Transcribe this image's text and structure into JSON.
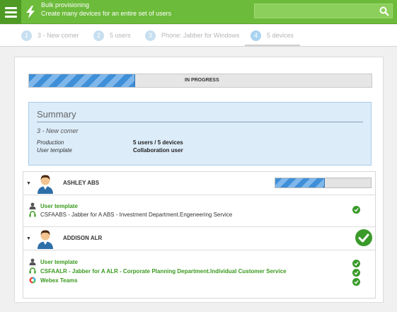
{
  "header": {
    "title": "Bulk provisioning",
    "subtitle": "Create many devices for an entire set of users",
    "search_value": ""
  },
  "steps": [
    {
      "num": "1",
      "label": "3 - New comer"
    },
    {
      "num": "2",
      "label": "5 users"
    },
    {
      "num": "3",
      "label": "Phone: Jabber for Windows"
    },
    {
      "num": "4",
      "label": "5 devices"
    }
  ],
  "progress": {
    "label": "IN PROGRESS",
    "fraction": 0.31
  },
  "summary": {
    "title": "Summary",
    "subtitle": "3 - New comer",
    "rows": [
      {
        "label": "Production",
        "value": "5 users / 5 devices"
      },
      {
        "label": "User template",
        "value": "Collaboration user"
      }
    ]
  },
  "users": [
    {
      "name": "ASHLEY ABS",
      "progress_fraction": 0.52,
      "items": [
        {
          "icon": "person-icon",
          "text": "User template",
          "style": "green"
        },
        {
          "icon": "headset-icon",
          "text": "CSFAABS - Jabber for A ABS - Investment Department.Engeneering Service",
          "style": "plain"
        }
      ]
    },
    {
      "name": "ADDISON ALR",
      "items": [
        {
          "icon": "person-icon",
          "text": "User template",
          "style": "green"
        },
        {
          "icon": "headset-icon",
          "text": "CSFAALR - Jabber for A ALR - Corporate Planning Department.Individual Customer Service",
          "style": "green"
        },
        {
          "icon": "webex-icon",
          "text": "Webex Teams",
          "style": "green"
        }
      ]
    }
  ],
  "colors": {
    "brand_green": "#6dbb3b",
    "progress_blue": "#3f8fd8",
    "success_green": "#3a9a2a"
  }
}
